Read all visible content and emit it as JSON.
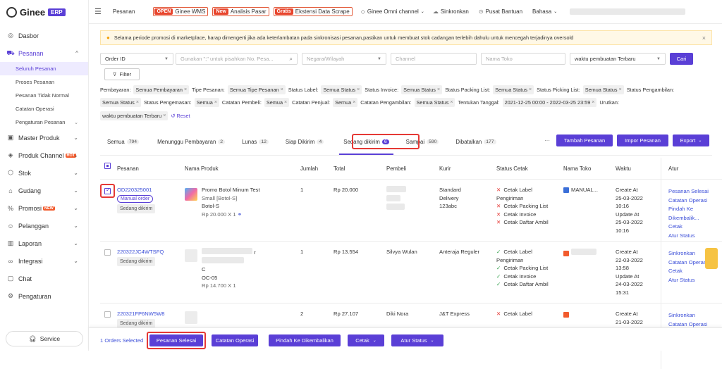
{
  "brand": {
    "name": "Ginee",
    "badge": "ERP"
  },
  "sidebar": {
    "items": [
      {
        "label": "Dasbor",
        "icon": "dashboard-icon"
      },
      {
        "label": "Pesanan",
        "icon": "cart-icon",
        "expanded": true
      },
      {
        "label": "Master Produk",
        "icon": "box-icon"
      },
      {
        "label": "Produk Channel",
        "icon": "tag-icon",
        "badge": "HOT"
      },
      {
        "label": "Stok",
        "icon": "stock-icon"
      },
      {
        "label": "Gudang",
        "icon": "warehouse-icon"
      },
      {
        "label": "Promosi",
        "icon": "promo-icon",
        "badge": "NEW"
      },
      {
        "label": "Pelanggan",
        "icon": "users-icon"
      },
      {
        "label": "Laporan",
        "icon": "chart-icon"
      },
      {
        "label": "Integrasi",
        "icon": "link-icon"
      },
      {
        "label": "Chat",
        "icon": "chat-icon"
      },
      {
        "label": "Pengaturan",
        "icon": "gear-icon"
      }
    ],
    "subitems": [
      "Seluruh Pesanan",
      "Proses Pesanan",
      "Pesanan Tidak Normal",
      "Catatan Operasi",
      "Pengaturan Pesanan"
    ],
    "service": "Service"
  },
  "topbar": {
    "pesanan": "Pesanan",
    "wms_tag": "OPEN",
    "wms_label": "Ginee WMS",
    "analisis_tag": "New",
    "analisis_label": "Analisis Pasar",
    "scrape_tag": "Gratis",
    "scrape_label": "Ekstensi Data Scrape",
    "omni": "Ginee Omni channel",
    "sync": "Sinkronkan",
    "help": "Pusat Bantuan",
    "lang": "Bahasa"
  },
  "notice": "Selama periode promosi di marketplace, harap dimengerti jika ada keterlambatan pada sinkronisasi pesanan,pastikan untuk membuat stok cadangan terlebih dahulu untuk mencegah terjadinya oversold",
  "search": {
    "order_id": "Order ID",
    "keyword_ph": "Gunakan \";\" untuk pisahkan No. Pesa...",
    "country_ph": "Negara/Wilayah",
    "channel_ph": "Channel",
    "store_ph": "Nama Toko",
    "sort": "waktu pembuatan Terbaru",
    "search_btn": "Cari",
    "filter_btn": "Filter"
  },
  "filters": {
    "line1": [
      {
        "label": "Pembayaran:",
        "value": "Semua Pembayaran"
      },
      {
        "label": "Tipe Pesanan:",
        "value": "Semua Tipe Pesanan"
      },
      {
        "label": "Status Label:",
        "value": "Semua Status"
      },
      {
        "label": "Status Invoice:",
        "value": "Semua Status"
      },
      {
        "label": "Status Packing List:",
        "value": "Semua Status"
      },
      {
        "label": "Status Picking List:",
        "value": "Semua Status"
      },
      {
        "label": "Status Pengambilan:",
        "value": ""
      }
    ],
    "line2": [
      {
        "label": "",
        "value": "Semua Status"
      },
      {
        "label": "Status Pengemasan:",
        "value": "Semua"
      },
      {
        "label": "Catatan Pembeli:",
        "value": "Semua"
      },
      {
        "label": "Catatan Penjual:",
        "value": "Semua"
      },
      {
        "label": "Catatan Pengambilan:",
        "value": "Semua Status"
      },
      {
        "label": "Tentukan Tanggal:",
        "value": "2021-12-25 00:00 - 2022-03-25 23:59"
      },
      {
        "label": "Urutkan:",
        "value": ""
      }
    ],
    "line3_value": "waktu pembuatan Terbaru",
    "reset": "Reset"
  },
  "tabs": [
    {
      "label": "Semua",
      "count": "794"
    },
    {
      "label": "Menunggu Pembayaran",
      "count": "2"
    },
    {
      "label": "Lunas",
      "count": "12"
    },
    {
      "label": "Siap Dikirim",
      "count": "4"
    },
    {
      "label": "Sedang dikirim",
      "count": "6"
    },
    {
      "label": "Sampai",
      "count": "590"
    },
    {
      "label": "Dibatalkan",
      "count": "177"
    }
  ],
  "actions": {
    "more": "···",
    "add": "Tambah Pesanan",
    "import": "Impor Pesanan",
    "export": "Export"
  },
  "columns": [
    "Pesanan",
    "Nama Produk",
    "Jumlah",
    "Total",
    "Pembeli",
    "Kurir",
    "Status Cetak",
    "Nama Toko",
    "Waktu",
    "Atur"
  ],
  "rows": [
    {
      "order_id": "OD220325001",
      "manual": "Manual order",
      "status": "Sedang dikirim",
      "product": "Promo Botol Minum Test",
      "variant": "Small [Botol-S]",
      "sku": "Botol-S",
      "price": "Rp 20.000 X 1",
      "qty": "1",
      "total": "Rp 20.000",
      "courier": [
        "Standard",
        "Delivery",
        "123abc"
      ],
      "print": [
        [
          "x",
          "Cetak Label Pengiriman"
        ],
        [
          "x",
          "Cetak Packing List"
        ],
        [
          "x",
          "Cetak Invoice"
        ],
        [
          "x",
          "Cetak Daftar Ambil"
        ]
      ],
      "store": "MANUAL...",
      "time": [
        "Create At",
        "25-03-2022",
        "10:16",
        "Update At",
        "25-03-2022",
        "10:16"
      ],
      "atur": [
        "Pesanan Selesai",
        "Catatan Operasi",
        "Pindah Ke Dikembalik...",
        "Cetak",
        "Atur Status"
      ]
    },
    {
      "order_id": "220322JC4WTSFQ",
      "status": "Sedang dikirim",
      "product_a": "r",
      "product_b": "C",
      "sku": "OC-05",
      "price": "Rp 14.700 X 1",
      "qty": "1",
      "total": "Rp 13.554",
      "buyer": "Silvya Wulan",
      "courier": [
        "Anteraja Reguler"
      ],
      "print": [
        [
          "ok",
          "Cetak Label Pengiriman"
        ],
        [
          "ok",
          "Cetak Packing List"
        ],
        [
          "ok",
          "Cetak Invoice"
        ],
        [
          "ok",
          "Cetak Daftar Ambil"
        ]
      ],
      "time": [
        "Create At",
        "22-03-2022",
        "13:58",
        "Update At",
        "24-03-2022",
        "15:31"
      ],
      "atur": [
        "Sinkronkan",
        "Catatan Operasi",
        "Cetak",
        "Atur Status"
      ]
    },
    {
      "order_id": "220321FP6NW5W8",
      "status": "Sedang dikirim",
      "qty": "2",
      "total": "Rp 27.107",
      "buyer": "Diki Nora",
      "courier": [
        "J&T Express"
      ],
      "print": [
        [
          "x",
          "Cetak Label"
        ]
      ],
      "time": [
        "Create At",
        "21-03-2022"
      ],
      "atur": [
        "Sinkronkan",
        "Catatan Operasi"
      ]
    }
  ],
  "bottom": {
    "selected": "1 Orders Selected",
    "b1": "Pesanan Selesai",
    "b2": "Catatan Operasi",
    "b3": "Pindah Ke Dikembalikan",
    "b4": "Cetak",
    "b5": "Atur Status"
  },
  "colors": {
    "accent": "#5a3fd6",
    "highlight": "#e53935",
    "link": "#3c4fd8"
  }
}
